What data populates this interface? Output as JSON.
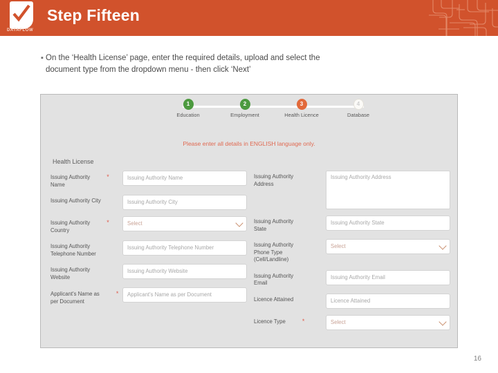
{
  "header": {
    "title": "Step Fifteen",
    "logo_word": "DATAFLOW",
    "brand_color": "#d1522c"
  },
  "bullet": {
    "marker": "▪",
    "line1": "On the ‘Health License’ page, enter the required details, upload and select the",
    "line2": "document type from the dropdown menu - then click ‘Next’"
  },
  "screenshot": {
    "stepper": {
      "steps": [
        {
          "number": "1",
          "label": "Education",
          "state": "done"
        },
        {
          "number": "2",
          "label": "Employment",
          "state": "done"
        },
        {
          "number": "3",
          "label": "Health Licence",
          "state": "active"
        },
        {
          "number": "4",
          "label": "Database",
          "state": "todo"
        }
      ],
      "colors": {
        "done": "#4c9a3f",
        "active": "#e2693a",
        "todo": "#fbfaf7"
      }
    },
    "notice": "Please enter all details in ENGLISH language only.",
    "section_title": "Health License",
    "left_fields": [
      {
        "label_line1": "Issuing Authority",
        "label_line2": "Name",
        "required": true,
        "type": "text",
        "placeholder": "Issuing Authority Name"
      },
      {
        "label_line1": "Issuing Authority City",
        "label_line2": "",
        "required": false,
        "type": "text",
        "placeholder": "Issuing Authority City"
      },
      {
        "label_line1": "Issuing Authority",
        "label_line2": "Country",
        "required": true,
        "type": "select",
        "placeholder": "Select"
      },
      {
        "label_line1": "Issuing Authority",
        "label_line2": "Telephone Number",
        "required": false,
        "type": "text",
        "placeholder": "Issuing Authority Telephone Number"
      },
      {
        "label_line1": "Issuing Authority",
        "label_line2": "Website",
        "required": false,
        "type": "text",
        "placeholder": "Issuing Authority Website"
      },
      {
        "label_line1": "Applicant's Name as",
        "label_line2": "per Document",
        "required": true,
        "type": "text",
        "placeholder": "Applicant's Name as per Document"
      }
    ],
    "right_fields": [
      {
        "label_line1": "Issuing Authority",
        "label_line2": "Address",
        "label_line3": "",
        "required": false,
        "type": "textarea",
        "placeholder": "Issuing Authority Address"
      },
      {
        "label_line1": "Issuing Authority",
        "label_line2": "State",
        "label_line3": "",
        "required": false,
        "type": "text",
        "placeholder": "Issuing Authority State"
      },
      {
        "label_line1": "Issuing Authority",
        "label_line2": "Phone Type",
        "label_line3": "(Cell/Landline)",
        "required": false,
        "type": "select",
        "placeholder": "Select"
      },
      {
        "label_line1": "Issuing Authority",
        "label_line2": "Email",
        "label_line3": "",
        "required": false,
        "type": "text",
        "placeholder": "Issuing Authority Email"
      },
      {
        "label_line1": "Licence Attained",
        "label_line2": "",
        "label_line3": "",
        "required": false,
        "type": "text",
        "placeholder": "Licence Attained"
      },
      {
        "label_line1": "Licence Type",
        "label_line2": "",
        "label_line3": "",
        "required": true,
        "type": "select",
        "placeholder": "Select"
      }
    ]
  },
  "page_number": "16"
}
